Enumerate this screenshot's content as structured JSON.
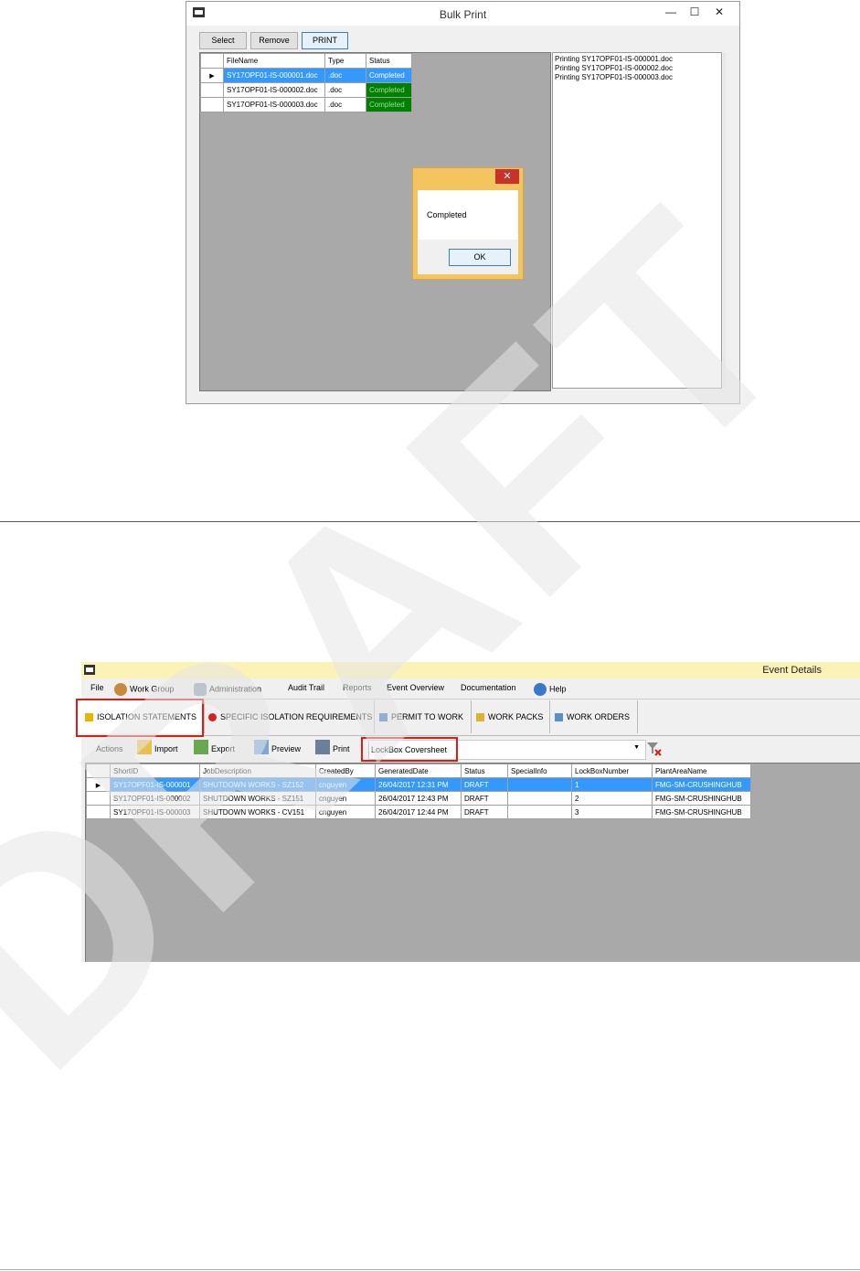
{
  "bulk_print": {
    "title": "Bulk Print",
    "controls": {
      "minimize": "—",
      "maximize": "☐",
      "close": "✕"
    },
    "buttons": {
      "select": "Select",
      "remove": "Remove",
      "print": "PRINT"
    },
    "columns": [
      "FileName",
      "Type",
      "Status"
    ],
    "rows": [
      {
        "file": "SY17OPF01-IS-000001.doc",
        "type": ".doc",
        "status": "Completed"
      },
      {
        "file": "SY17OPF01-IS-000002.doc",
        "type": ".doc",
        "status": "Completed"
      },
      {
        "file": "SY17OPF01-IS-000003.doc",
        "type": ".doc",
        "status": "Completed"
      }
    ],
    "log": [
      "Printing SY17OPF01-IS-000001.doc",
      "Printing SY17OPF01-IS-000002.doc",
      "Printing SY17OPF01-IS-000003.doc"
    ],
    "dialog": {
      "message": "Completed",
      "ok": "OK",
      "close": "✕"
    }
  },
  "event_details": {
    "title": "Event Details",
    "menu": [
      "File",
      "Work Group",
      "Administration",
      "Audit Trail",
      "Reports",
      "Event Overview",
      "Documentation",
      "Help"
    ],
    "tabs": [
      "ISOLATION STATEMENTS",
      "SPECIFIC ISOLATION REQUIREMENTS",
      "PERMIT TO WORK",
      "WORK PACKS",
      "WORK ORDERS"
    ],
    "toolbar": {
      "actions": "Actions",
      "import": "Import",
      "export": "Export",
      "preview": "Preview",
      "print": "Print"
    },
    "lockbox_selected": "LockBox Coversheet",
    "columns": [
      "ShortID",
      "JobDescription",
      "CreatedBy",
      "GeneratedDate",
      "Status",
      "SpecialInfo",
      "LockBoxNumber",
      "PlantAreaName"
    ],
    "rows": [
      [
        "SY17OPF01-IS-000001",
        "SHUTDOWN WORKS - SZ152",
        "cnguyen",
        "26/04/2017 12:31 PM",
        "DRAFT",
        "",
        "1",
        "FMG-SM-CRUSHINGHUB"
      ],
      [
        "SY17OPF01-IS-000002",
        "SHUTDOWN WORKS - SZ151",
        "cnguyen",
        "26/04/2017 12:43 PM",
        "DRAFT",
        "",
        "2",
        "FMG-SM-CRUSHINGHUB"
      ],
      [
        "SY17OPF01-IS-000003",
        "SHUTDOWN WORKS - CV151",
        "cnguyen",
        "26/04/2017 12:44 PM",
        "DRAFT",
        "",
        "3",
        "FMG-SM-CRUSHINGHUB"
      ]
    ]
  },
  "watermark": {
    "text": "DRAFT",
    "color": "#e6e6e6"
  },
  "colors": {
    "selection": "#3399ff",
    "status_green": "#008000",
    "highlight_red": "#d91e18",
    "dialog_frame": "#f4c45e",
    "ed_titlebar": "#fbf2b5"
  }
}
